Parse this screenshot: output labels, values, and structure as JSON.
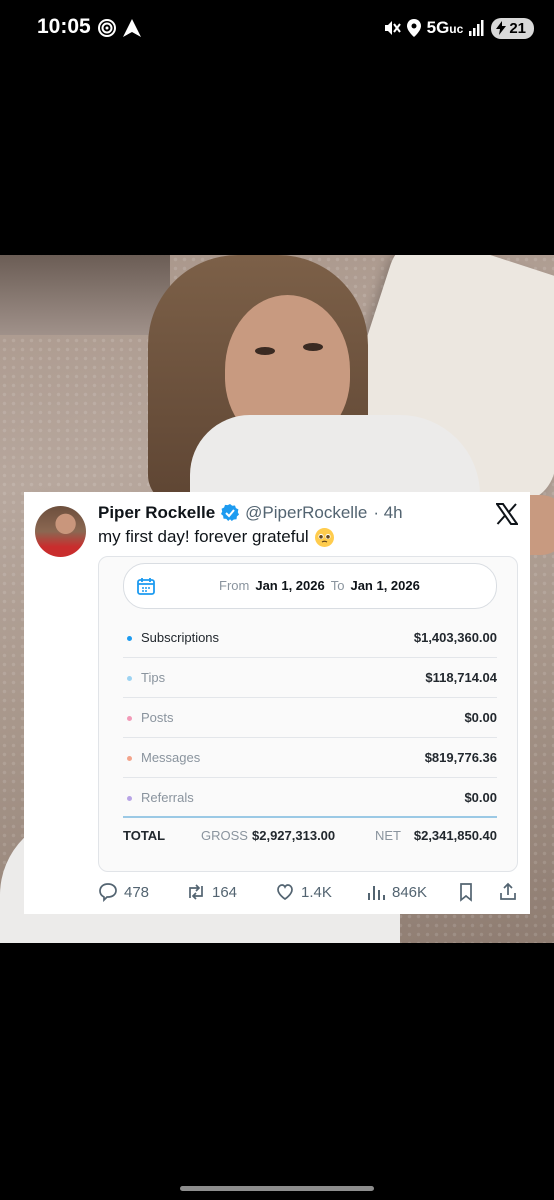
{
  "status_bar": {
    "time": "10:05",
    "network": "5G",
    "network_suffix": "uc",
    "battery": "21",
    "icons": [
      "nfc-icon",
      "navigation-icon",
      "mute-icon",
      "location-icon",
      "signal-icon",
      "battery-charging-icon"
    ]
  },
  "tweet": {
    "name": "Piper Rockelle",
    "handle": "@PiperRockelle",
    "time": "· 4h",
    "text": "my first day! forever grateful",
    "emoji": "pleading-face",
    "verified": true
  },
  "earnings": {
    "date_from_label": "From",
    "date_from": "Jan 1, 2026",
    "date_to_label": "To",
    "date_to": "Jan 1, 2026",
    "rows": [
      {
        "label": "Subscriptions",
        "value": "$1,403,360.00",
        "color": "#1d9bf0"
      },
      {
        "label": "Tips",
        "value": "$118,714.04",
        "color": "#9dd3f2"
      },
      {
        "label": "Posts",
        "value": "$0.00",
        "color": "#f29ab8"
      },
      {
        "label": "Messages",
        "value": "$819,776.36",
        "color": "#f3a48b"
      },
      {
        "label": "Referrals",
        "value": "$0.00",
        "color": "#b8a4e6"
      }
    ],
    "total_label": "TOTAL",
    "gross_label": "GROSS",
    "gross_value": "$2,927,313.00",
    "net_label": "NET",
    "net_value": "$2,341,850.40"
  },
  "actions": {
    "replies": "478",
    "reposts": "164",
    "likes": "1.4K",
    "views": "846K"
  }
}
